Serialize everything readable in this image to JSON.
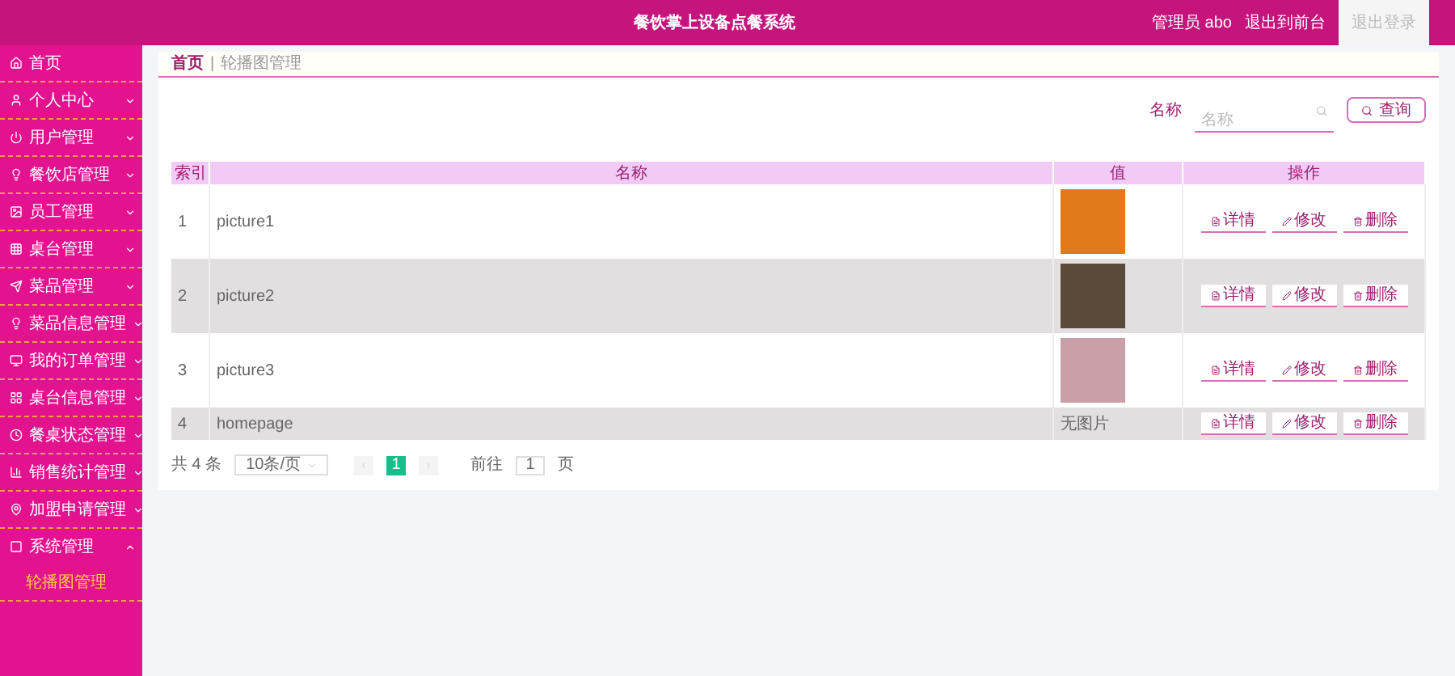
{
  "header": {
    "title": "餐饮掌上设备点餐系统",
    "links": [
      {
        "label": "管理员 abo",
        "highlighted": false
      },
      {
        "label": "退出到前台",
        "highlighted": false
      },
      {
        "label": "退出登录",
        "highlighted": true
      }
    ]
  },
  "sidebar": {
    "items": [
      {
        "label": "首页",
        "kind": "link"
      },
      {
        "label": "个人中心",
        "kind": "menu",
        "expanded": false
      },
      {
        "label": "用户管理",
        "kind": "menu",
        "expanded": false
      },
      {
        "label": "餐饮店管理",
        "kind": "menu",
        "expanded": false
      },
      {
        "label": "员工管理",
        "kind": "menu",
        "expanded": false
      },
      {
        "label": "桌台管理",
        "kind": "menu",
        "expanded": false
      },
      {
        "label": "菜品管理",
        "kind": "menu",
        "expanded": false
      },
      {
        "label": "菜品信息管理",
        "kind": "menu",
        "expanded": false
      },
      {
        "label": "我的订单管理",
        "kind": "menu",
        "expanded": false
      },
      {
        "label": "桌台信息管理",
        "kind": "menu",
        "expanded": false
      },
      {
        "label": "餐桌状态管理",
        "kind": "menu",
        "expanded": false
      },
      {
        "label": "销售统计管理",
        "kind": "menu",
        "expanded": false
      },
      {
        "label": "加盟申请管理",
        "kind": "menu",
        "expanded": false
      },
      {
        "label": "系统管理",
        "kind": "menu",
        "expanded": true,
        "children": [
          {
            "label": "轮播图管理",
            "selected": true
          }
        ]
      }
    ]
  },
  "breadcrumb": {
    "items": [
      "首页",
      "轮播图管理"
    ],
    "separator": "|"
  },
  "search": {
    "label": "名称",
    "placeholder": "名称",
    "button": "查询"
  },
  "table": {
    "columns": [
      "索引",
      "名称",
      "值",
      "操作"
    ],
    "rows": [
      {
        "index": "1",
        "name": "picture1",
        "kind": "image",
        "actions": [
          "详情",
          "修改",
          "删除"
        ]
      },
      {
        "index": "2",
        "name": "picture2",
        "kind": "image",
        "actions": [
          "详情",
          "修改",
          "删除"
        ]
      },
      {
        "index": "3",
        "name": "picture3",
        "kind": "image",
        "actions": [
          "详情",
          "修改",
          "删除"
        ]
      },
      {
        "index": "4",
        "name": "homepage",
        "kind": "text",
        "value": "无图片",
        "actions": [
          "详情",
          "修改",
          "删除"
        ]
      }
    ]
  },
  "pagination": {
    "total": "共 4 条",
    "page_size": "10条/页",
    "pages": [
      {
        "label": "1",
        "selected": true
      }
    ],
    "goto_label": "前往",
    "goto_value": "1",
    "goto_suffix": "页"
  }
}
